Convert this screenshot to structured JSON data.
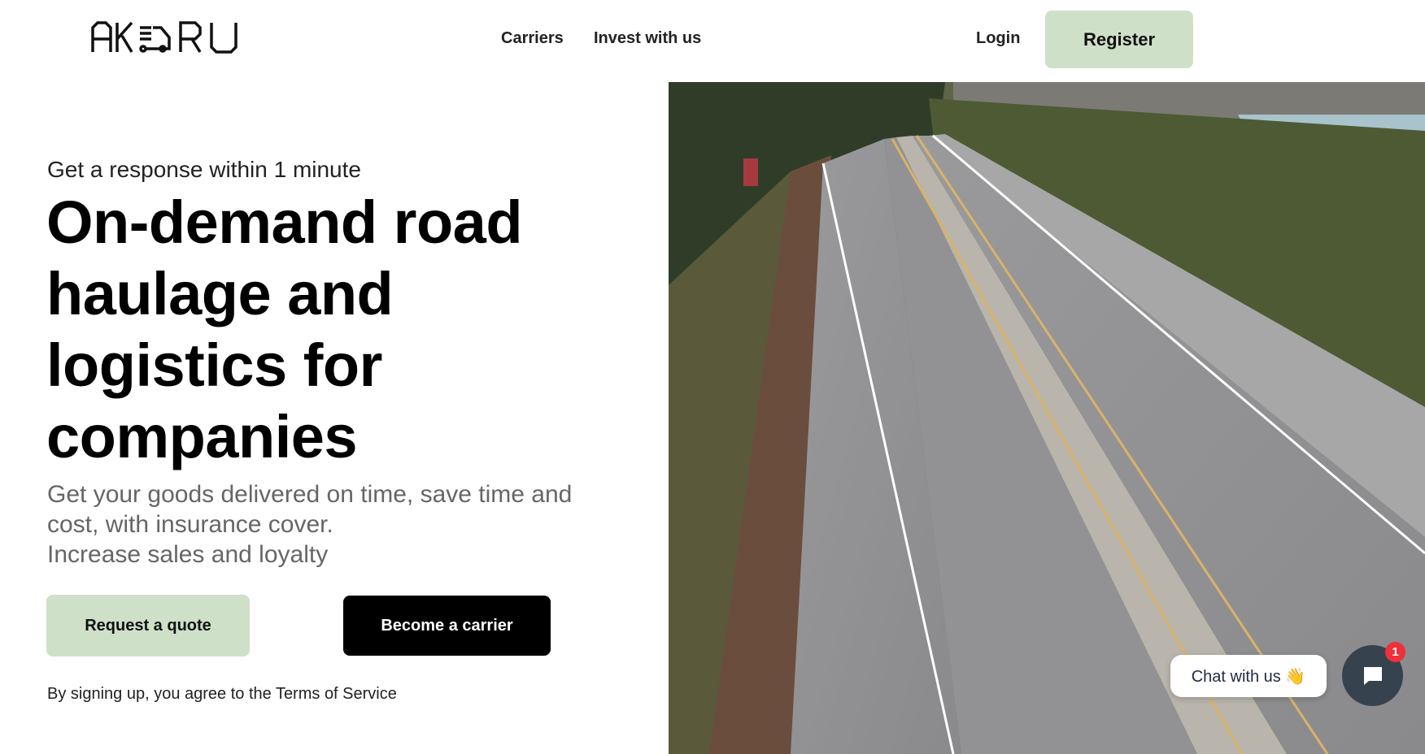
{
  "nav": {
    "logo_text": "AK RU",
    "links": [
      "Carriers",
      "Invest with us"
    ],
    "login": "Login",
    "register": "Register"
  },
  "hero": {
    "kicker": "Get a response within 1 minute",
    "title": "On-demand road haulage and logistics for companies",
    "subtitle_1": "Get your goods delivered on time, save time and cost, with insurance cover.",
    "subtitle_2": "Increase sales and loyalty",
    "request_quote": "Request a quote",
    "become_carrier": "Become a carrier",
    "terms": "By signing up, you agree to the Terms of Service"
  },
  "chat": {
    "label": "Chat with us 👋",
    "badge": "1"
  },
  "colors": {
    "accent": "#cfe0c9",
    "chat": "#37424f",
    "badge": "#f0303a"
  }
}
